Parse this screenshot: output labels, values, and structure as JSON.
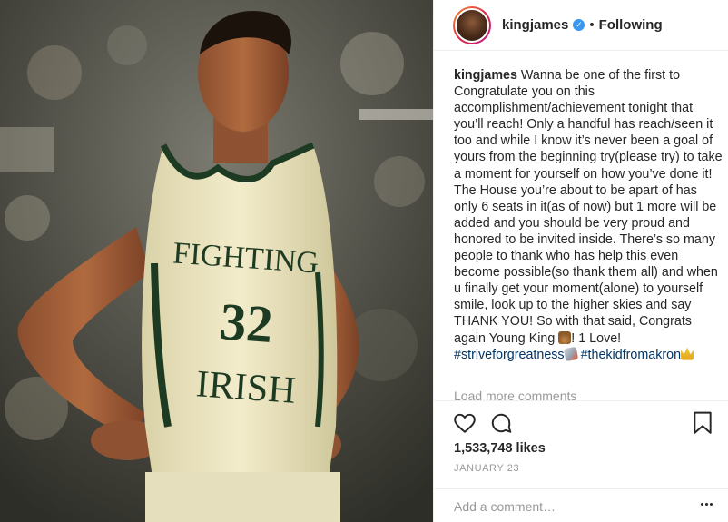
{
  "header": {
    "username": "kingjames",
    "verified_icon": "verified-badge-icon",
    "separator": "•",
    "follow_status": "Following"
  },
  "caption": {
    "username": "kingjames",
    "text_main": "Wanna be one of the first to Congratulate you on this accomplishment/achievement tonight that you’ll reach! Only a handful has reach/seen it too and while I know it’s never been a goal of yours from the beginning try(please try) to take a moment for yourself on how you’ve done it! The House you’re about to be apart of has only 6 seats in it(as of now) but 1 more will be added and you should be very proud and honored to be invited inside. There’s so many people to thank who has help this even become possible(so thank them all) and when u finally get your moment(alone) to yourself smile, look up to the higher skies and say THANK YOU! So with that said, Congrats again Young King",
    "text_love": "! 1 Love!",
    "hashtag_1": "#striveforgreatness",
    "hashtag_2": "#thekidfromakron"
  },
  "comments": {
    "load_more": "Load more comments"
  },
  "actions": {
    "like_icon": "heart-icon",
    "comment_icon": "comment-icon",
    "save_icon": "bookmark-icon"
  },
  "likes": "1,533,748 likes",
  "date": "JANUARY 23",
  "comment_input": {
    "placeholder": "Add a comment…"
  },
  "more_icon": "more-options-icon",
  "photo": {
    "jersey_text_top": "FIGHTING",
    "jersey_number": "32",
    "jersey_text_bottom": "IRISH"
  }
}
